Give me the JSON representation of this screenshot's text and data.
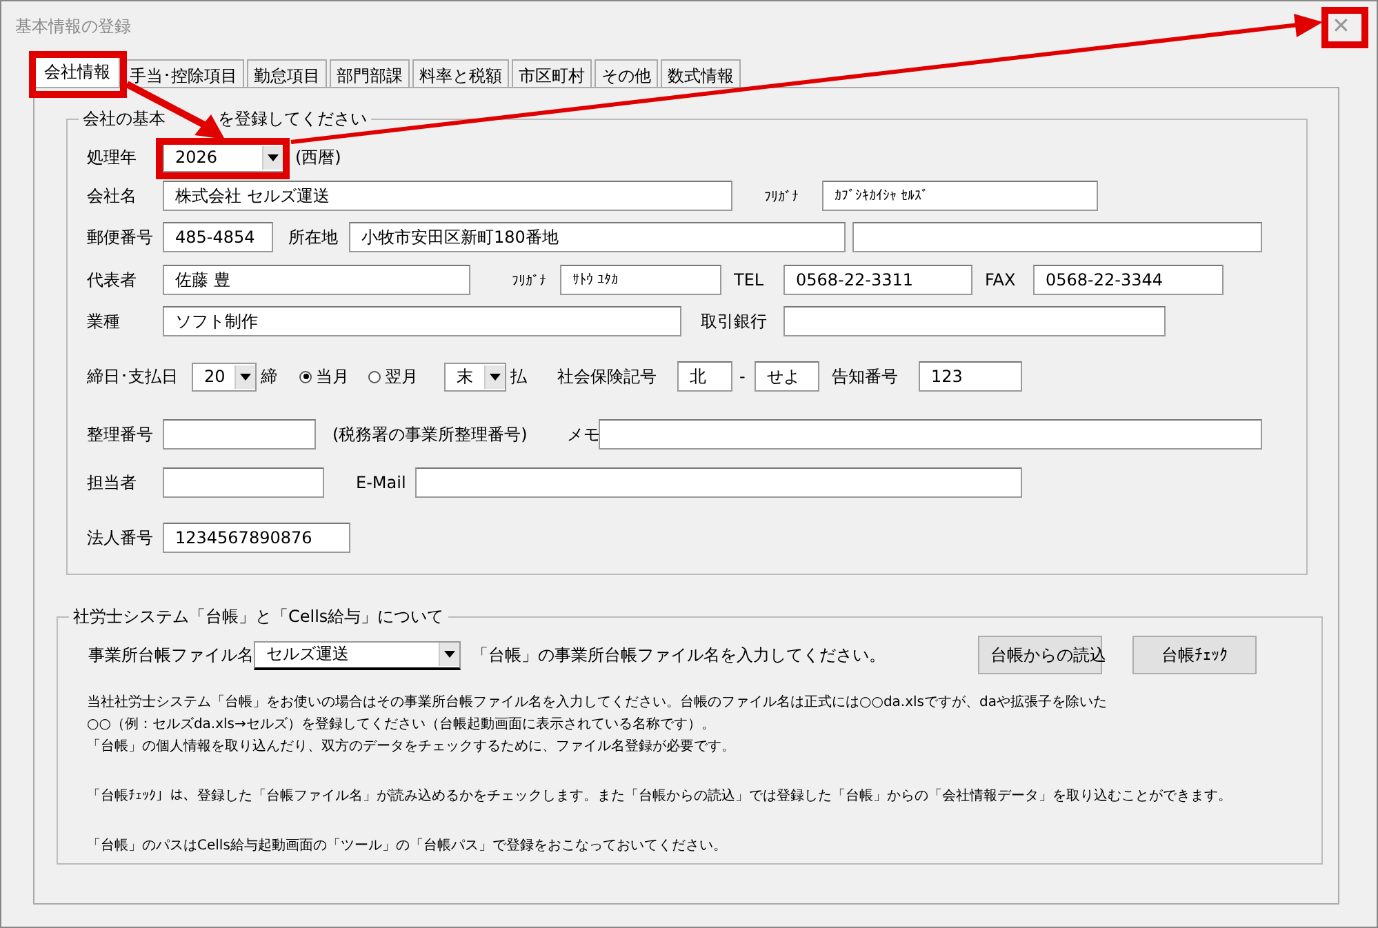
{
  "window": {
    "title": "基本情報の登録",
    "close": "✕"
  },
  "tabs": [
    {
      "label": "会社情報",
      "selected": true
    },
    {
      "label": "手当･控除項目",
      "selected": false
    },
    {
      "label": "勤怠項目",
      "selected": false
    },
    {
      "label": "部門部課",
      "selected": false
    },
    {
      "label": "料率と税額",
      "selected": false
    },
    {
      "label": "市区町村",
      "selected": false
    },
    {
      "label": "その他",
      "selected": false
    },
    {
      "label": "数式情報",
      "selected": false
    }
  ],
  "company_group": {
    "title_parts": [
      "会社の基本",
      "を登録してください"
    ],
    "lines": [
      {
        "items": [
          {
            "kind": "label",
            "text": "処理年"
          },
          {
            "kind": "select",
            "value": "2026"
          },
          {
            "kind": "label",
            "text": "(西暦)"
          }
        ]
      },
      {
        "items": [
          {
            "kind": "label",
            "text": "会社名"
          },
          {
            "kind": "field",
            "value": "株式会社  セルズ運送"
          },
          {
            "kind": "small",
            "text": "ﾌﾘｶﾞﾅ"
          },
          {
            "kind": "kana",
            "value": "ｶﾌﾞｼｷｶｲｼｬ ｾﾙｽﾞ"
          }
        ]
      },
      {
        "items": [
          {
            "kind": "label",
            "text": "郵便番号"
          },
          {
            "kind": "field",
            "value": "485-4854"
          },
          {
            "kind": "label",
            "text": "所在地"
          },
          {
            "kind": "field",
            "value": "小牧市安田区新町180番地"
          },
          {
            "kind": "field"
          }
        ]
      },
      {
        "items": [
          {
            "kind": "label",
            "text": "代表者"
          },
          {
            "kind": "field",
            "value": "佐藤 豊"
          },
          {
            "kind": "small",
            "text": "ﾌﾘｶﾞﾅ"
          },
          {
            "kind": "kana",
            "value": "ｻﾄｳ ﾕﾀｶ"
          },
          {
            "kind": "label",
            "text": "TEL"
          },
          {
            "kind": "field",
            "value": "0568-22-3311"
          },
          {
            "kind": "label",
            "text": "FAX"
          },
          {
            "kind": "field",
            "value": "0568-22-3344"
          }
        ]
      },
      {
        "items": [
          {
            "kind": "label",
            "text": "業種"
          },
          {
            "kind": "field",
            "value": "ソフト制作"
          },
          {
            "kind": "label",
            "text": "取引銀行"
          },
          {
            "kind": "field"
          }
        ]
      },
      {
        "items": [
          {
            "kind": "label",
            "text": "締日･支払日"
          },
          {
            "kind": "select",
            "value": "20"
          },
          {
            "kind": "label",
            "text": "締"
          },
          {
            "kind": "radio",
            "text": "当月",
            "selected": true
          },
          {
            "kind": "radio",
            "text": "翌月",
            "selected": false
          },
          {
            "kind": "select",
            "value": "末"
          },
          {
            "kind": "label",
            "text": "払"
          },
          {
            "kind": "label",
            "text": "社会保険記号"
          },
          {
            "kind": "field",
            "value": "北"
          },
          {
            "kind": "label",
            "text": "-"
          },
          {
            "kind": "field",
            "value": "せよ"
          },
          {
            "kind": "label",
            "text": "告知番号"
          },
          {
            "kind": "field",
            "value": "123"
          }
        ]
      },
      {
        "items": [
          {
            "kind": "label",
            "text": "整理番号"
          },
          {
            "kind": "field"
          },
          {
            "kind": "label",
            "text": "(税務署の事業所整理番号)"
          },
          {
            "kind": "label",
            "text": "メモ"
          },
          {
            "kind": "field"
          }
        ]
      },
      {
        "items": [
          {
            "kind": "label",
            "text": "担当者"
          },
          {
            "kind": "field"
          },
          {
            "kind": "label",
            "text": "E-Mail"
          },
          {
            "kind": "field"
          }
        ]
      },
      {
        "items": [
          {
            "kind": "label",
            "text": "法人番号"
          },
          {
            "kind": "field",
            "value": "1234567890876"
          }
        ]
      }
    ]
  },
  "daicho_group": {
    "title": "社労士システム「台帳」と「Cells給与」について",
    "file_label": "事業所台帳ファイル名",
    "file_value": "セルズ運送",
    "file_hint": "「台帳」の事業所台帳ファイル名を入力してください。",
    "buttons": [
      "台帳からの読込",
      "台帳ﾁｪｯｸ"
    ],
    "paragraphs": [
      [
        "当社社労士システム「台帳」をお使いの場合はその事業所台帳ファイル名を入力してください。台帳のファイル名は正式には○○da.xlsですが、daや拡張子を除いた",
        "○○（例：セルズda.xls→セルズ）を登録してください（台帳起動画面に表示されている名称です）。",
        "「台帳」の個人情報を取り込んだり、双方のデータをチェックするために、ファイル名登録が必要です。"
      ],
      [
        "「台帳ﾁｪｯｸ」は、登録した「台帳ファイル名」が読み込めるかをチェックします。また「台帳からの読込」では登録した「台帳」からの「会社情報データ」を取り込むことができます。"
      ],
      [
        "「台帳」のパスはCells給与起動画面の「ツール」の「台帳パス」で登録をおこなっておいてください。"
      ]
    ]
  }
}
